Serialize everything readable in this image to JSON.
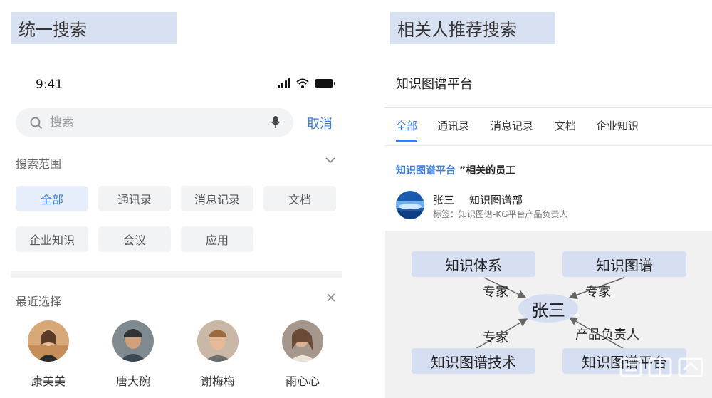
{
  "left_section": {
    "tag": "统一搜索",
    "status_time": "9:41",
    "search": {
      "placeholder": "搜索",
      "cancel_label": "取消"
    },
    "scope": {
      "label": "搜索范围",
      "chips": [
        "全部",
        "通讯录",
        "消息记录",
        "文档",
        "企业知识",
        "会议",
        "应用"
      ],
      "active": "全部"
    },
    "recent": {
      "label": "最近选择",
      "people": [
        "康美美",
        "唐大碗",
        "谢梅梅",
        "雨心心"
      ]
    }
  },
  "right_section": {
    "tag": "相关人推荐搜索",
    "title": "知识图谱平台",
    "tabs": [
      "全部",
      "通讯录",
      "消息记录",
      "文档",
      "企业知识"
    ],
    "active_tab": "全部",
    "heading_keyword": "知识图谱平台",
    "heading_suffix": " ”相关的员工",
    "employee": {
      "name": "张三",
      "dept": "知识图谱部",
      "tags": "标签：知识图谱-KG平台产品负责人"
    },
    "graph": {
      "center": "张三",
      "nodes": [
        "知识体系",
        "知识图谱",
        "知识图谱技术",
        "知识图谱平台"
      ],
      "edge_labels": [
        "专家",
        "专家",
        "专家",
        "产品负责人"
      ]
    }
  },
  "colors": {
    "accent": "#3b7be8",
    "chip_bg": "#f2f3f5",
    "node_bg": "#d6dff1",
    "tag_bg": "#d8e1f2"
  }
}
